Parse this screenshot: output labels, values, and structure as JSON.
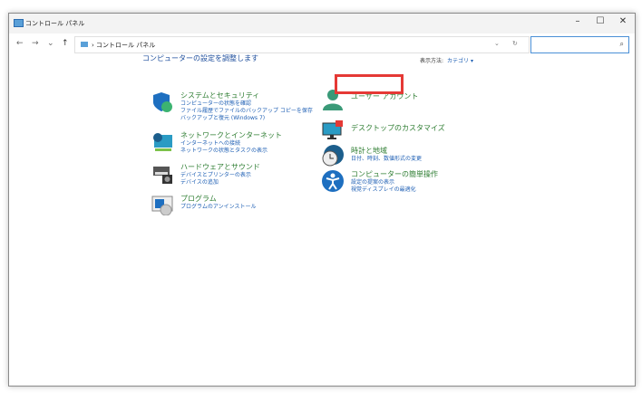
{
  "window": {
    "title": "コントロール パネル",
    "minimize": "–",
    "maximize": "☐",
    "close": "✕"
  },
  "nav": {
    "back": "←",
    "forward": "→",
    "recent": "⌄",
    "up": "↑",
    "path": "› コントロール パネル",
    "dropdown": "⌄",
    "refresh": "↻",
    "search_placeholder": "",
    "search_icon": "⌕"
  },
  "main": {
    "heading": "コンピューターの設定を調整します",
    "view_label": "表示方法:",
    "view_value": "カテゴリ ▾",
    "left": [
      {
        "title": "システムとセキュリティ",
        "icon": "shield-icon",
        "links": [
          "コンピューターの状態を確認",
          "ファイル履歴でファイルのバックアップ コピーを保存",
          "バックアップと復元 (Windows 7)"
        ]
      },
      {
        "title": "ネットワークとインターネット",
        "icon": "network-icon",
        "links": [
          "インターネットへの接続",
          "ネットワークの状態とタスクの表示"
        ]
      },
      {
        "title": "ハードウェアとサウンド",
        "icon": "printer-icon",
        "links": [
          "デバイスとプリンターの表示",
          "デバイスの追加"
        ]
      },
      {
        "title": "プログラム",
        "icon": "programs-icon",
        "links": [
          "プログラムのアンインストール"
        ]
      }
    ],
    "right": [
      {
        "title": "ユーザー アカウント",
        "icon": "user-icon",
        "links": []
      },
      {
        "title": "デスクトップのカスタマイズ",
        "icon": "desktop-icon",
        "links": []
      },
      {
        "title": "時計と地域",
        "icon": "clock-icon",
        "links": [
          "日付、時刻、数値形式の変更"
        ]
      },
      {
        "title": "コンピューターの簡単操作",
        "icon": "accessibility-icon",
        "links": [
          "設定の提案の表示",
          "視覚ディスプレイの最適化"
        ]
      }
    ]
  },
  "highlight_color": "#e53935"
}
